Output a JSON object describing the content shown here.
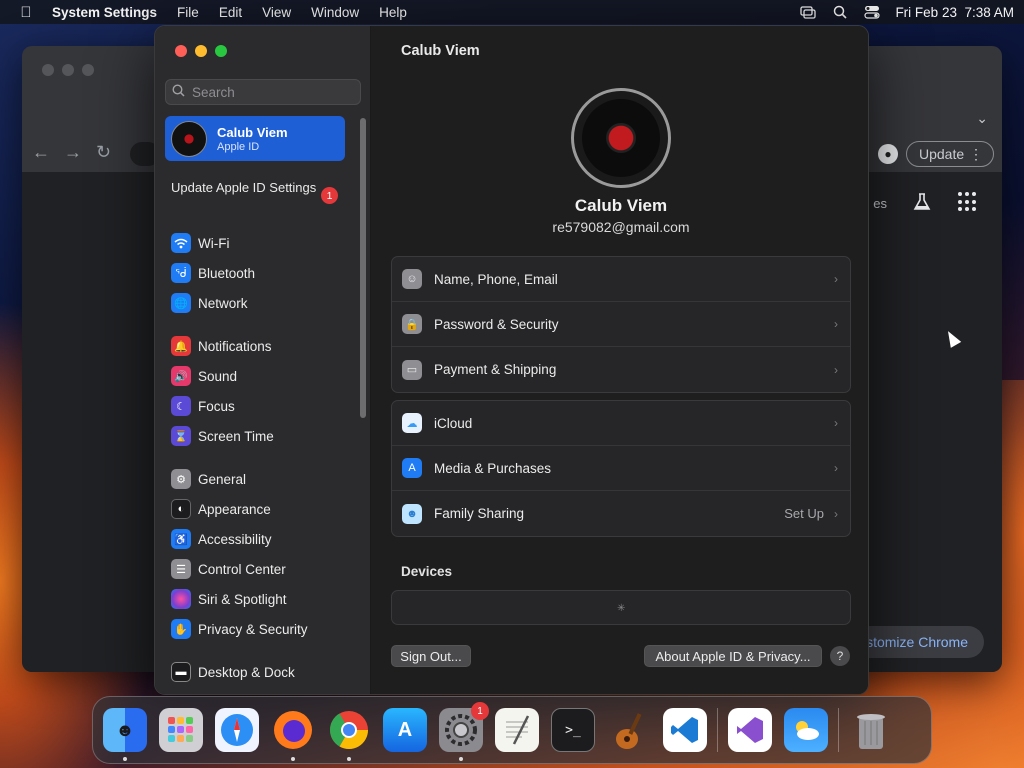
{
  "menubar": {
    "app_name": "System Settings",
    "items": [
      "File",
      "Edit",
      "View",
      "Window",
      "Help"
    ],
    "datetime": "Fri Feb 23  7:38 AM"
  },
  "chrome": {
    "update_label": "Update",
    "shortcut_text": "es",
    "customize_label": "ustomize Chrome"
  },
  "sidebar": {
    "search_placeholder": "Search",
    "account": {
      "name": "Calub Viem",
      "sub": "Apple ID"
    },
    "update_notice": {
      "label": "Update Apple ID Settings",
      "badge": "1"
    },
    "items": [
      {
        "label": "Wi-Fi",
        "icon": "wifi-icon",
        "color": "#1f7cf4"
      },
      {
        "label": "Bluetooth",
        "icon": "bluetooth-icon",
        "color": "#1f7cf4"
      },
      {
        "label": "Network",
        "icon": "network-icon",
        "color": "#1f7cf4"
      },
      {
        "label": "Notifications",
        "icon": "notifications-icon",
        "color": "#e5383b"
      },
      {
        "label": "Sound",
        "icon": "sound-icon",
        "color": "#e5386b"
      },
      {
        "label": "Focus",
        "icon": "focus-icon",
        "color": "#5b4ad6"
      },
      {
        "label": "Screen Time",
        "icon": "screen-time-icon",
        "color": "#5b4ad6"
      },
      {
        "label": "General",
        "icon": "general-icon",
        "color": "#8e8e93"
      },
      {
        "label": "Appearance",
        "icon": "appearance-icon",
        "color": "#1c1c1e"
      },
      {
        "label": "Accessibility",
        "icon": "accessibility-icon",
        "color": "#1f7cf4"
      },
      {
        "label": "Control Center",
        "icon": "control-center-icon",
        "color": "#8e8e93"
      },
      {
        "label": "Siri & Spotlight",
        "icon": "siri-icon",
        "color": "#7b3fd0"
      },
      {
        "label": "Privacy & Security",
        "icon": "privacy-icon",
        "color": "#1f7cf4"
      },
      {
        "label": "Desktop & Dock",
        "icon": "desktop-dock-icon",
        "color": "#1c1c1e"
      }
    ]
  },
  "main": {
    "title": "Calub Viem",
    "profile_name": "Calub Viem",
    "profile_email": "re579082@gmail.com",
    "group1": [
      {
        "label": "Name, Phone, Email",
        "icon": "person-icon",
        "color": "#8e8e93"
      },
      {
        "label": "Password & Security",
        "icon": "lock-icon",
        "color": "#8e8e93"
      },
      {
        "label": "Payment & Shipping",
        "icon": "card-icon",
        "color": "#8e8e93"
      }
    ],
    "group2": [
      {
        "label": "iCloud",
        "icon": "icloud-icon",
        "color": "#e8f2ff",
        "value": ""
      },
      {
        "label": "Media & Purchases",
        "icon": "app-store-icon",
        "color": "#1f7cf4",
        "value": ""
      },
      {
        "label": "Family Sharing",
        "icon": "family-icon",
        "color": "#bfe4ff",
        "value": "Set Up"
      }
    ],
    "devices_label": "Devices",
    "sign_out_label": "Sign Out...",
    "about_label": "About Apple ID & Privacy...",
    "help_label": "?"
  },
  "dock": {
    "settings_badge": "1"
  }
}
